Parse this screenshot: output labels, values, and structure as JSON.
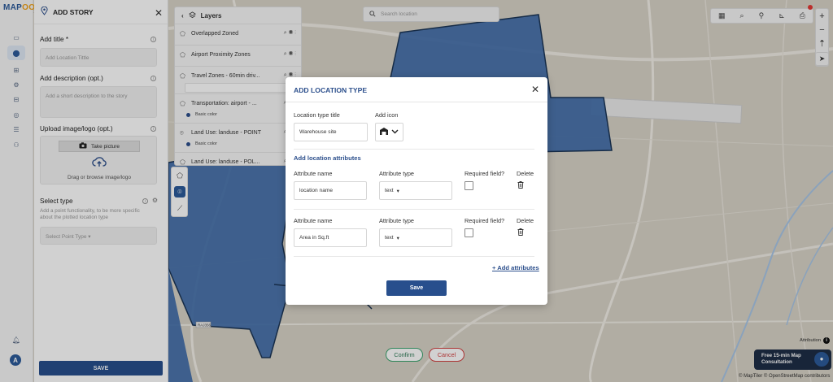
{
  "app": {
    "logo_text": "MAP",
    "logo_accent": "O",
    "accent_color": "#2c4f8c"
  },
  "story_panel": {
    "title": "ADD STORY",
    "title_label": "Add title *",
    "title_placeholder": "Add Location Tittle",
    "description_label": "Add description (opt.)",
    "description_placeholder": "Add a short description to the story",
    "upload_label": "Upload image/logo (opt.)",
    "take_picture": "Take picture",
    "drag_text": "Drag or browse image/logo",
    "select_type_label": "Select type",
    "select_type_help": "Add a point functionality, to be more specific about the plotted location type",
    "select_point_type": "Select Point Type",
    "save": "SAVE",
    "avatar_initial": "A"
  },
  "layers": {
    "title": "Layers",
    "items": [
      {
        "name": "Overlapped Zoned",
        "type": "polygon"
      },
      {
        "name": "Airport Proximity Zones",
        "type": "polygon"
      },
      {
        "name": "Travel Zones - 60min driv...",
        "type": "polygon"
      },
      {
        "name": "Transportation: airport - ...",
        "type": "polygon",
        "legend": "Basic color"
      },
      {
        "name": "Land Use: landuse - POINT",
        "type": "point",
        "legend": "Basic color"
      },
      {
        "name": "Land Use: landuse - POL...",
        "type": "polygon"
      }
    ]
  },
  "search": {
    "placeholder": "Search location"
  },
  "map_buttons": {
    "confirm": "Confirm",
    "cancel": "Cancel",
    "attribution": "Attribution",
    "consult_line1": "Free 15-min Map",
    "consult_line2": "Consultation",
    "copyright": "© MapTiler © OpenStreetMap contributors",
    "road_label": "RAJ356"
  },
  "modal": {
    "title": "ADD LOCATION TYPE",
    "type_title_label": "Location type title",
    "type_title_value": "Warehouse site",
    "add_icon_label": "Add icon",
    "attributes_section": "Add location attributes",
    "columns": {
      "name": "Attribute name",
      "type": "Attribute type",
      "required": "Required field?",
      "delete": "Delete"
    },
    "attributes": [
      {
        "name": "location name",
        "type": "text",
        "required": false
      },
      {
        "name": "Area in Sq.ft",
        "type": "text",
        "required": false
      }
    ],
    "add_attributes": "+ Add attributes",
    "save": "Save"
  },
  "colors": {
    "zone_fill": "#3d6aa8",
    "zone_stroke": "#1b3556",
    "confirm": "#3aa46e",
    "cancel": "#d24040"
  }
}
